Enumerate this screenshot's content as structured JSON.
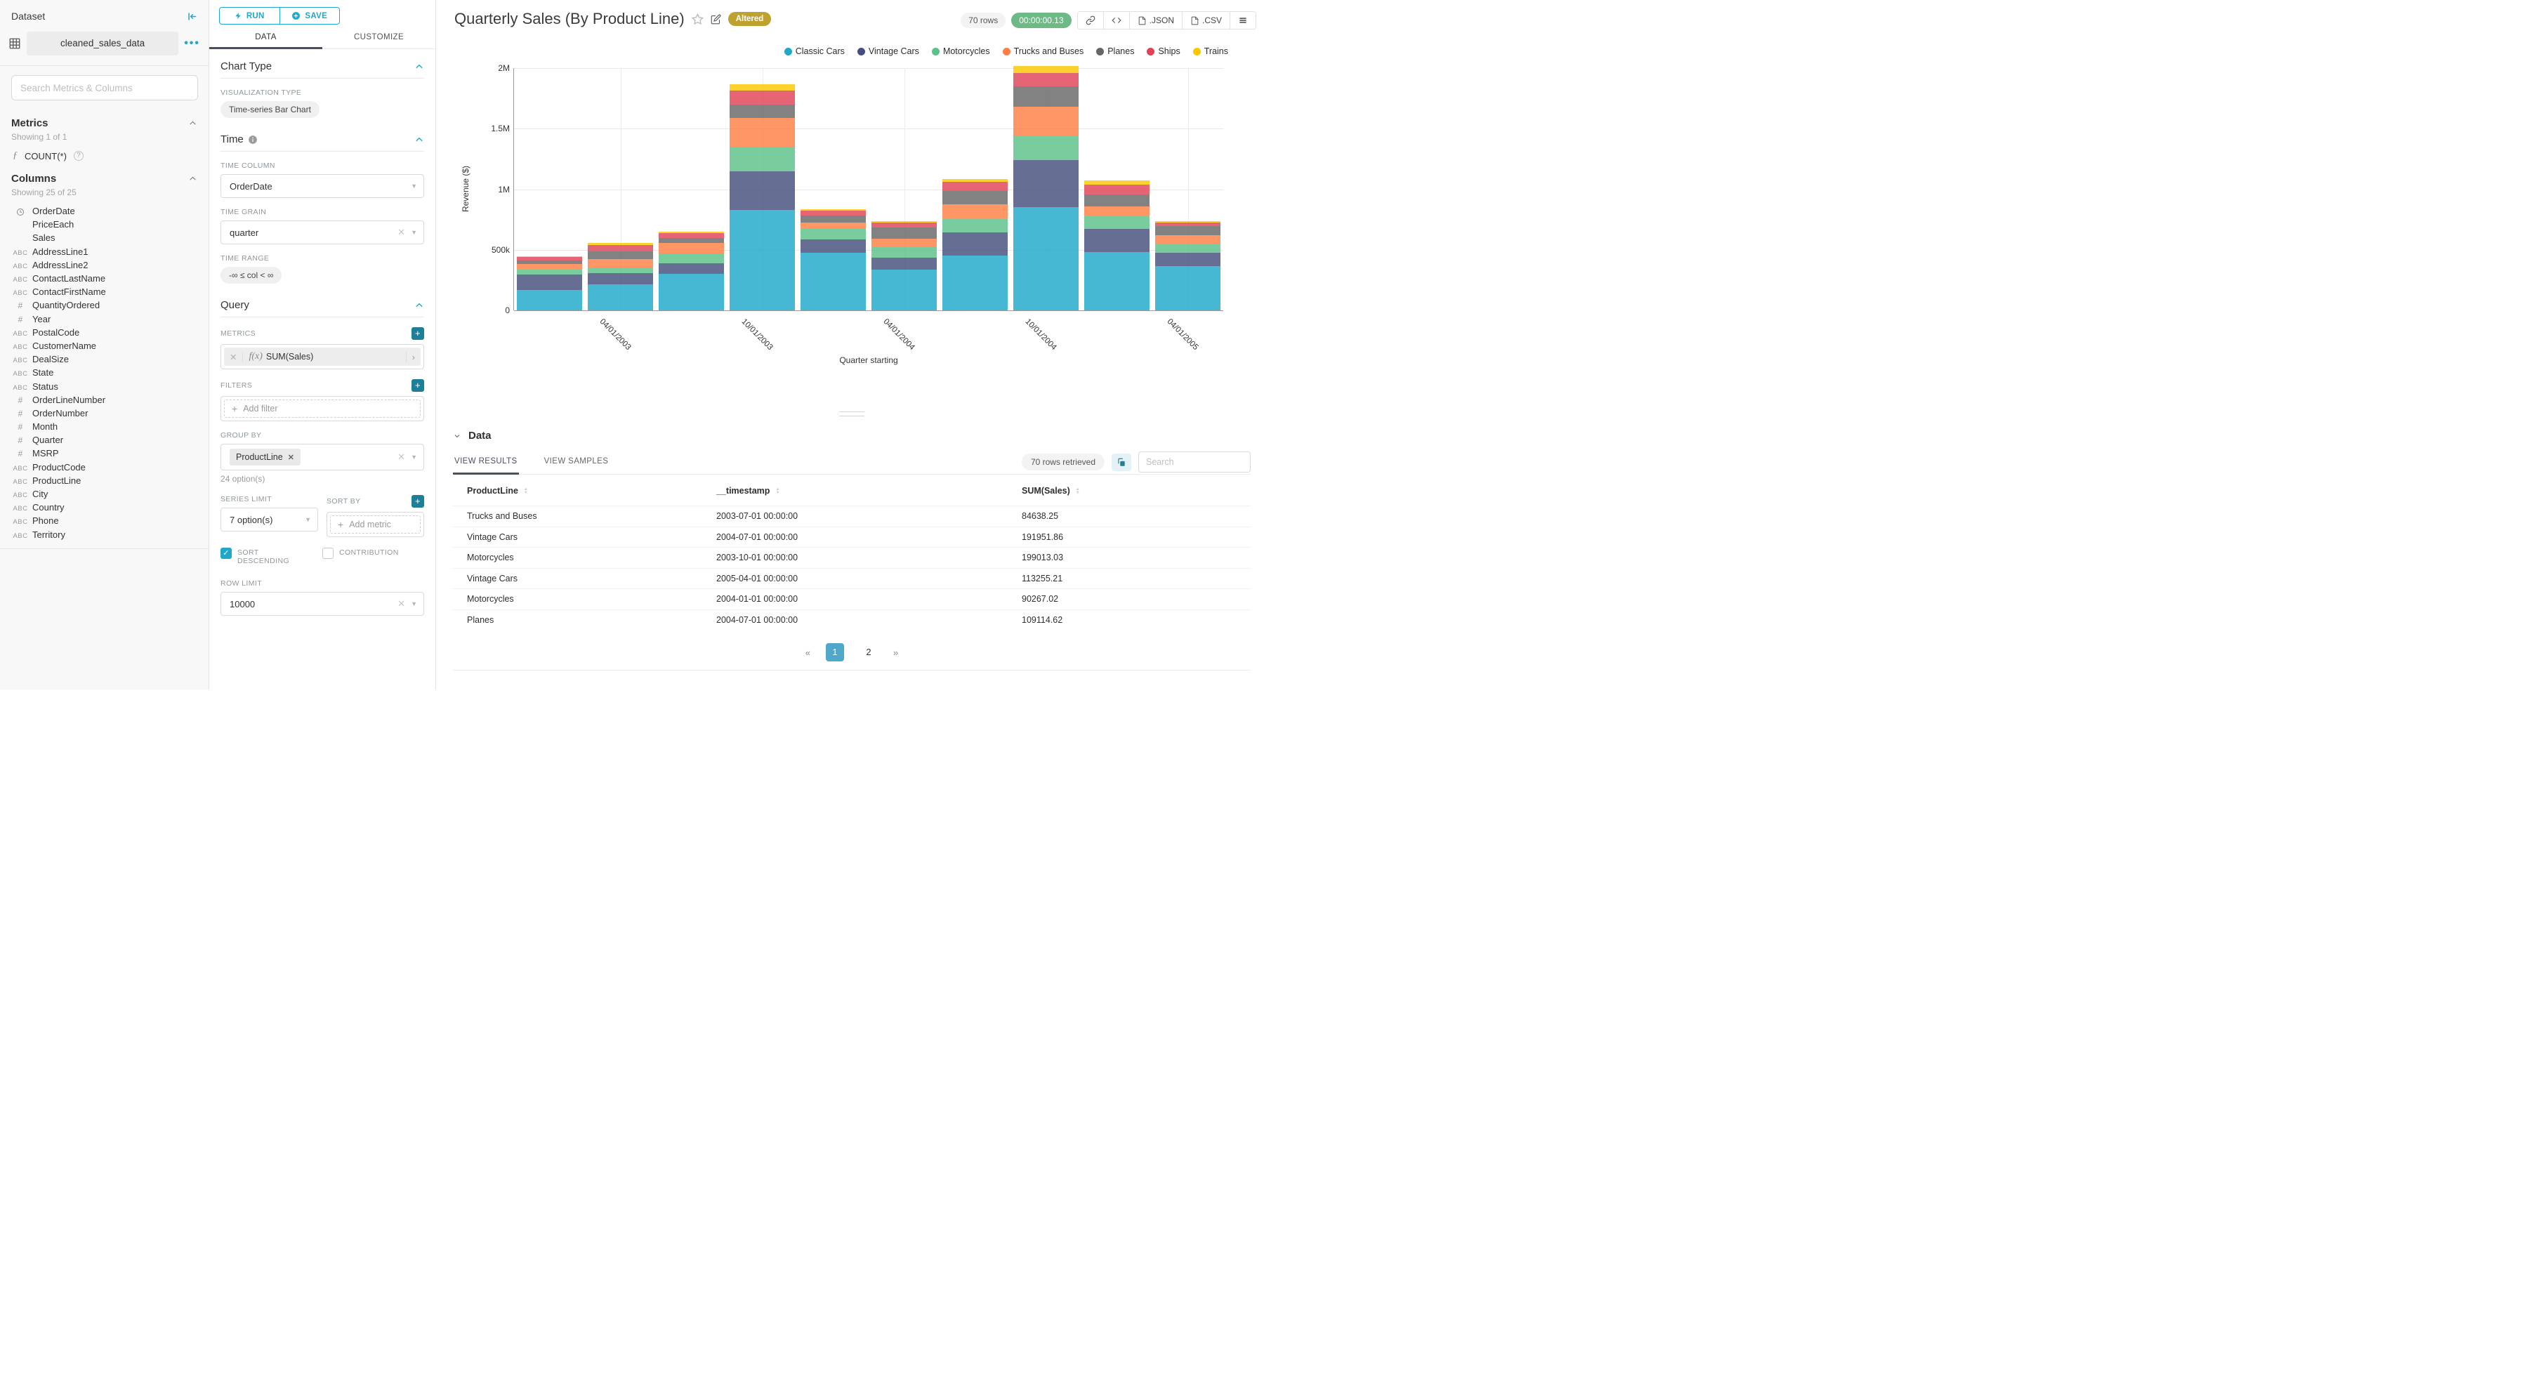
{
  "colors": {
    "accent": "#20A7C9",
    "accent_dark": "#1E7F99",
    "tab_active_underline": "#484F63",
    "altered_badge": "#BEA12F",
    "timer_pill": "#6DBA87",
    "active_page": "#4FA8C9"
  },
  "sidebar": {
    "title": "Dataset",
    "dataset_name": "cleaned_sales_data",
    "search_placeholder": "Search Metrics & Columns",
    "metrics": {
      "header": "Metrics",
      "showing": "Showing 1 of 1",
      "items": [
        {
          "label": "COUNT(*)",
          "icon": "function"
        }
      ]
    },
    "columns": {
      "header": "Columns",
      "showing": "Showing 25 of 25",
      "items": [
        {
          "label": "OrderDate",
          "type": "time"
        },
        {
          "label": "PriceEach",
          "type": ""
        },
        {
          "label": "Sales",
          "type": ""
        },
        {
          "label": "AddressLine1",
          "type": "text"
        },
        {
          "label": "AddressLine2",
          "type": "text"
        },
        {
          "label": "ContactLastName",
          "type": "text"
        },
        {
          "label": "ContactFirstName",
          "type": "text"
        },
        {
          "label": "QuantityOrdered",
          "type": "num"
        },
        {
          "label": "Year",
          "type": "num"
        },
        {
          "label": "PostalCode",
          "type": "text"
        },
        {
          "label": "CustomerName",
          "type": "text"
        },
        {
          "label": "DealSize",
          "type": "text"
        },
        {
          "label": "State",
          "type": "text"
        },
        {
          "label": "Status",
          "type": "text"
        },
        {
          "label": "OrderLineNumber",
          "type": "num"
        },
        {
          "label": "OrderNumber",
          "type": "num"
        },
        {
          "label": "Month",
          "type": "num"
        },
        {
          "label": "Quarter",
          "type": "num"
        },
        {
          "label": "MSRP",
          "type": "num"
        },
        {
          "label": "ProductCode",
          "type": "text"
        },
        {
          "label": "ProductLine",
          "type": "text"
        },
        {
          "label": "City",
          "type": "text"
        },
        {
          "label": "Country",
          "type": "text"
        },
        {
          "label": "Phone",
          "type": "text"
        },
        {
          "label": "Territory",
          "type": "text"
        }
      ]
    }
  },
  "panel": {
    "run_label": "RUN",
    "save_label": "SAVE",
    "tab_data": "DATA",
    "tab_customize": "CUSTOMIZE",
    "chart_type": {
      "header": "Chart Type",
      "viz_label": "VISUALIZATION TYPE",
      "viz_value": "Time-series Bar Chart"
    },
    "time": {
      "header": "Time",
      "col_label": "TIME COLUMN",
      "col_value": "OrderDate",
      "grain_label": "TIME GRAIN",
      "grain_value": "quarter",
      "range_label": "TIME RANGE",
      "range_value": "-∞ ≤ col < ∞"
    },
    "query": {
      "header": "Query",
      "metrics_label": "METRICS",
      "metric_fx": "f(x)",
      "metric_value": "SUM(Sales)",
      "filters_label": "FILTERS",
      "add_filter": "Add filter",
      "group_by_label": "GROUP BY",
      "group_by_chip": "ProductLine",
      "group_by_hint": "24 option(s)",
      "series_limit_label": "SERIES LIMIT",
      "series_limit_value": "7 option(s)",
      "sort_by_label": "SORT BY",
      "add_metric": "Add metric",
      "sort_descending_label": "SORT DESCENDING",
      "contribution_label": "CONTRIBUTION",
      "row_limit_label": "ROW LIMIT",
      "row_limit_value": "10000"
    }
  },
  "header": {
    "title": "Quarterly Sales (By Product Line)",
    "altered_badge": "Altered",
    "rows_pill": "70 rows",
    "timer": "00:00:00.13",
    "export_json_label": ".JSON",
    "export_csv_label": ".CSV"
  },
  "chart_data": {
    "type": "bar",
    "stacked": true,
    "title": "Quarterly Sales (By Product Line)",
    "xlabel": "Quarter starting",
    "ylabel": "Revenue ($)",
    "ylim": [
      0,
      2000000
    ],
    "ytick_labels": [
      "0",
      "500k",
      "1M",
      "1.5M",
      "2M"
    ],
    "grid": true,
    "legend_position": "top",
    "x": [
      "2003-01-01",
      "2003-04-01",
      "2003-07-01",
      "2003-10-01",
      "2004-01-01",
      "2004-04-01",
      "2004-07-01",
      "2004-10-01",
      "2005-01-01",
      "2005-04-01"
    ],
    "x_tick_labels": [
      "",
      "04/01/2003",
      "",
      "10/01/2003",
      "",
      "04/01/2004",
      "",
      "10/01/2004",
      "",
      "04/01/2005"
    ],
    "series": [
      {
        "name": "Classic Cars",
        "color": "#1FA8C9",
        "values": [
          170000,
          215000,
          300000,
          830000,
          475000,
          335000,
          450000,
          850000,
          480000,
          365000
        ]
      },
      {
        "name": "Vintage Cars",
        "color": "#454E7C",
        "values": [
          125000,
          95000,
          90000,
          320000,
          110000,
          100000,
          191951.86,
          390000,
          190000,
          113255.21
        ]
      },
      {
        "name": "Motorcycles",
        "color": "#5AC189",
        "values": [
          40000,
          40000,
          80000,
          199013.03,
          90267.02,
          90000,
          120000,
          200000,
          110000,
          75000
        ]
      },
      {
        "name": "Trucks and Buses",
        "color": "#FF7F44",
        "values": [
          45000,
          75000,
          84638.25,
          240000,
          50000,
          65000,
          115000,
          240000,
          80000,
          70000
        ]
      },
      {
        "name": "Planes",
        "color": "#666666",
        "values": [
          33000,
          60000,
          40000,
          110000,
          55000,
          95000,
          109114.62,
          170000,
          95000,
          70000
        ]
      },
      {
        "name": "Ships",
        "color": "#E04355",
        "values": [
          25000,
          55000,
          45000,
          115000,
          45000,
          40000,
          75000,
          110000,
          85000,
          30000
        ]
      },
      {
        "name": "Trains",
        "color": "#FCC700",
        "values": [
          10000,
          15000,
          10000,
          55000,
          12000,
          10000,
          25000,
          55000,
          30000,
          15000
        ]
      }
    ]
  },
  "data_panel": {
    "title": "Data",
    "tab_results": "VIEW RESULTS",
    "tab_samples": "VIEW SAMPLES",
    "rows_retrieved": "70 rows retrieved",
    "search_placeholder": "Search",
    "table": {
      "headers": [
        "ProductLine",
        "__timestamp",
        "SUM(Sales)"
      ],
      "rows": [
        [
          "Trucks and Buses",
          "2003-07-01 00:00:00",
          "84638.25"
        ],
        [
          "Vintage Cars",
          "2004-07-01 00:00:00",
          "191951.86"
        ],
        [
          "Motorcycles",
          "2003-10-01 00:00:00",
          "199013.03"
        ],
        [
          "Vintage Cars",
          "2005-04-01 00:00:00",
          "113255.21"
        ],
        [
          "Motorcycles",
          "2004-01-01 00:00:00",
          "90267.02"
        ],
        [
          "Planes",
          "2004-07-01 00:00:00",
          "109114.62"
        ]
      ]
    },
    "pagination": {
      "prev": "«",
      "pages": [
        "1",
        "2"
      ],
      "active": "1",
      "next": "»"
    }
  }
}
